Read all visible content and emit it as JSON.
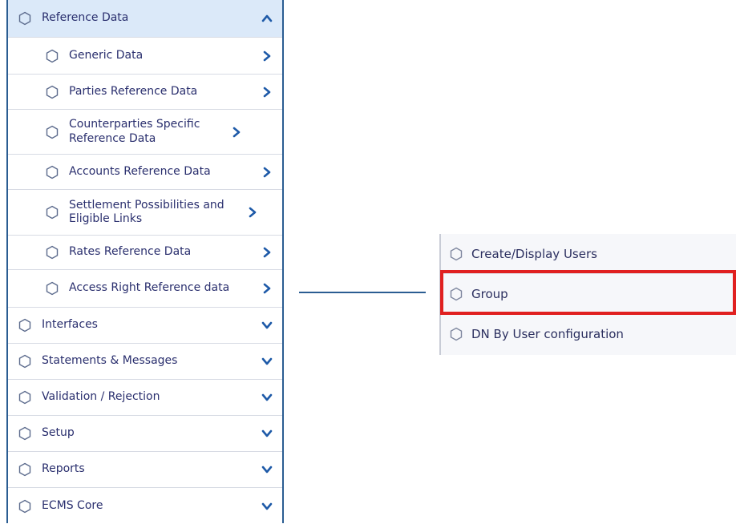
{
  "menu": {
    "items": [
      {
        "label": "Reference Data",
        "chevron": "chevron-up-icon",
        "level": "top",
        "expanded": true
      },
      {
        "label": "Generic Data",
        "chevron": "chevron-right-icon",
        "level": "sub"
      },
      {
        "label": "Parties Reference Data",
        "chevron": "chevron-right-icon",
        "level": "sub"
      },
      {
        "label": "Counterparties Specific Reference Data",
        "chevron": "chevron-right-icon",
        "level": "sub"
      },
      {
        "label": "Accounts Reference Data",
        "chevron": "chevron-right-icon",
        "level": "sub"
      },
      {
        "label": "Settlement Possibilities and Eligible Links",
        "chevron": "chevron-right-icon",
        "level": "sub"
      },
      {
        "label": "Rates Reference Data",
        "chevron": "chevron-right-icon",
        "level": "sub"
      },
      {
        "label": "Access Right Reference data",
        "chevron": "chevron-right-icon",
        "level": "sub"
      },
      {
        "label": "Interfaces",
        "chevron": "chevron-down-icon",
        "level": "main"
      },
      {
        "label": "Statements & Messages",
        "chevron": "chevron-down-icon",
        "level": "main"
      },
      {
        "label": "Validation / Rejection",
        "chevron": "chevron-down-icon",
        "level": "main"
      },
      {
        "label": "Setup",
        "chevron": "chevron-down-icon",
        "level": "main"
      },
      {
        "label": "Reports",
        "chevron": "chevron-down-icon",
        "level": "main"
      },
      {
        "label": "ECMS Core",
        "chevron": "chevron-down-icon",
        "level": "main"
      }
    ]
  },
  "submenu": {
    "items": [
      {
        "label": "Create/Display Users"
      },
      {
        "label": "Group",
        "highlighted": true
      },
      {
        "label": "DN By User configuration"
      }
    ]
  },
  "colors": {
    "accent": "#2b5d92",
    "highlight_border": "#e02020",
    "selected_bg": "#dbe9f9"
  }
}
